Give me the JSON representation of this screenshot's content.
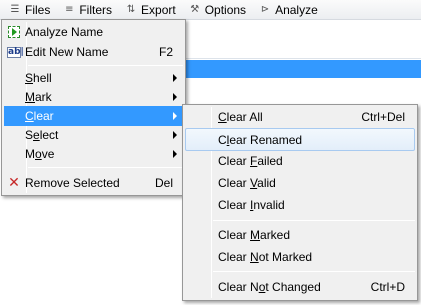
{
  "toolbar": {
    "items": [
      {
        "label": "Files",
        "icon": "files-icon",
        "glyph": "☰"
      },
      {
        "label": "Filters",
        "icon": "filters-icon",
        "glyph": "≡"
      },
      {
        "label": "Export",
        "icon": "export-icon",
        "glyph": "⇅"
      },
      {
        "label": "Options",
        "icon": "options-icon",
        "glyph": "⚒"
      },
      {
        "label": "Analyze",
        "icon": "analyze-icon",
        "glyph": "⊳"
      }
    ]
  },
  "main_menu": {
    "items": [
      {
        "label": "Analyze Name",
        "icon": "analyze-name-icon"
      },
      {
        "label": "Edit New Name",
        "shortcut": "F2",
        "icon": "edit-name-icon",
        "icon_text": "ab|"
      },
      {
        "label_pre": "",
        "label_u": "S",
        "label_post": "hell"
      },
      {
        "label_pre": "",
        "label_u": "M",
        "label_post": "ark"
      },
      {
        "label_pre": "",
        "label_u": "C",
        "label_post": "lear"
      },
      {
        "label_pre": "S",
        "label_u": "e",
        "label_post": "lect"
      },
      {
        "label_pre": "M",
        "label_u": "o",
        "label_post": "ve"
      },
      {
        "label": "Remove Selected",
        "shortcut": "Del",
        "icon": "remove-icon",
        "icon_text": "✕"
      }
    ]
  },
  "clear_submenu": {
    "items": [
      {
        "label_pre": "",
        "label_u": "C",
        "label_post": "lear All",
        "shortcut": "Ctrl+Del"
      },
      {
        "label_pre": "C",
        "label_u": "l",
        "label_post": "ear Renamed"
      },
      {
        "label_pre": "Clear ",
        "label_u": "F",
        "label_post": "ailed"
      },
      {
        "label_pre": "Clear ",
        "label_u": "V",
        "label_post": "alid"
      },
      {
        "label_pre": "Clear ",
        "label_u": "I",
        "label_post": "nvalid"
      },
      {
        "label_pre": "Clear ",
        "label_u": "M",
        "label_post": "arked"
      },
      {
        "label_pre": "Clear ",
        "label_u": "N",
        "label_post": "ot Marked"
      },
      {
        "label_pre": "Clear N",
        "label_u": "o",
        "label_post": "t Changed",
        "shortcut": "Ctrl+D"
      }
    ]
  },
  "colors": {
    "highlight": "#3399ff",
    "menu_bg": "#f0f0f0"
  }
}
